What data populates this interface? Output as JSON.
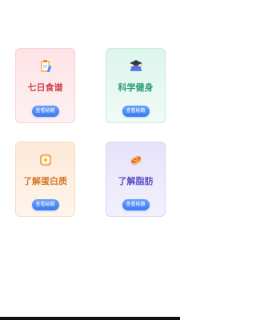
{
  "cards": [
    {
      "title": "七日食谱",
      "button_label": "查看秘籍",
      "icon": "recipe-clipboard-icon",
      "accent": "#d2434f"
    },
    {
      "title": "科学健身",
      "button_label": "查看秘籍",
      "icon": "books-graduation-cap-icon",
      "accent": "#2f9c74"
    },
    {
      "title": "了解蛋白质",
      "button_label": "查看秘籍",
      "icon": "fried-egg-toast-icon",
      "accent": "#d27a2d"
    },
    {
      "title": "了解脂肪",
      "button_label": "查看秘籍",
      "icon": "hotdog-icon",
      "accent": "#5a4fbf"
    }
  ],
  "colors": {
    "button": "#3c78f0",
    "background": "#ffffff"
  }
}
